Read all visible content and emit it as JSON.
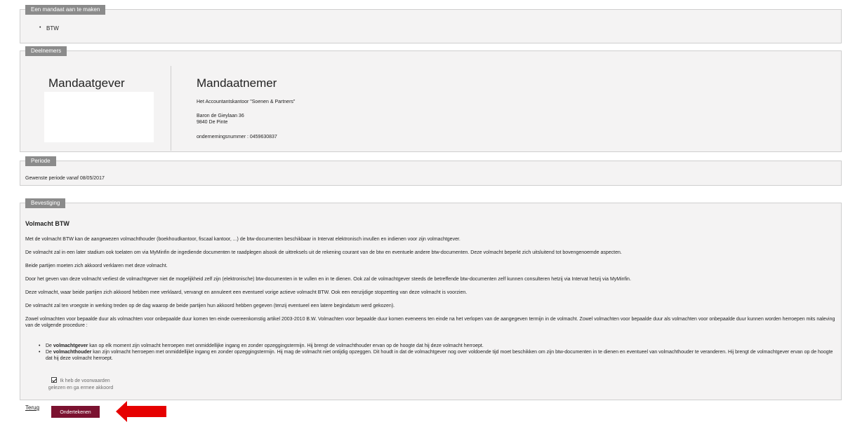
{
  "mandaat": {
    "legend": "Een mandaat aan te maken",
    "items": [
      "BTW"
    ]
  },
  "deelnemers": {
    "legend": "Deelnemers",
    "giver_title": "Mandaatgever",
    "taker_title": "Mandaatnemer",
    "taker_name": "Het Accountantskantoor \"Soenen & Partners\"",
    "taker_street": "Baron de Gieylaan 36",
    "taker_city": "9840 De Pinte",
    "taker_company_number": "ondernemingsnummer : 0459630837"
  },
  "periode": {
    "legend": "Periode",
    "text": "Gewenste periode vanaf 08/05/2017"
  },
  "bevestiging": {
    "legend": "Bevestiging",
    "title": "Volmacht BTW",
    "paragraphs": [
      "Met de volmacht BTW kan de aangewezen volmachthouder (boekhoudkantoor, fiscaal kantoor, ...) de btw-documenten beschikbaar in Intervat elektronisch invullen en indienen voor zijn volmachtgever.",
      "De volmacht zal in een later stadium ook toelaten om via MyMinfin de ingediende documenten te raadplegen alsook de uittreksels uit de rekening courant van de btw en eventuele andere btw-documenten. Deze volmacht beperkt zich uitsluitend tot bovengenoemde aspecten.",
      "Beide partijen moeten zich akkoord verklaren met deze volmacht.",
      "Door het geven van deze volmacht verliest de volmachtgever niet de mogelijkheid zelf zijn (elektronische) btw-documenten in te vullen en in te dienen. Ook zal de volmachtgever steeds de betreffende btw-documenten zelf kunnen consulteren hetzij via Intervat hetzij via MyMinfin.",
      "Deze volmacht, waar beide partijen zich akkoord hebben mee verklaard, vervangt en annuleert een eventueel vorige actieve volmacht BTW. Ook een eenzijdige stopzetting van deze volmacht is voorzien.",
      "De volmacht zal ten vroegste in werking treden op de dag waarop de beide partijen hun akkoord hebben gegeven (tenzij eventueel een latere begindatum werd gekozen).",
      "Zowel volmachten voor bepaalde duur als volmachten voor onbepaalde duur komen ten einde overeenkomstig artikel 2003-2010 B.W. Volmachten voor bepaalde duur komen eveneens ten einde na het verlopen van de aangegeven termijn in de volmacht. Zowel volmachten voor bepaalde duur als volmachten voor onbepaalde duur kunnen worden herroepen mits naleving van de volgende procedure :"
    ],
    "list": [
      {
        "prefix": "De ",
        "bold": "volmachtgever",
        "text": " kan op elk moment zijn volmacht herroepen met onmiddellijke ingang en zonder opzeggingstermijn. Hij brengt de volmachthouder ervan op de hoogte dat hij deze volmacht herroept."
      },
      {
        "prefix": "De ",
        "bold": "volmachthouder",
        "text": " kan zijn volmacht herroepen met onmiddellijke ingang en zonder opzeggingstermijn. Hij mag de volmacht niet ontijdig opzeggen. Dit houdt in dat de volmachtgever nog over voldoende tijd moet beschikken om zijn btw-documenten in te dienen en eventueel van volmachthouder te veranderen. Hij brengt de volmachtgever ervan op de hoogte dat hij deze volmacht herroept."
      }
    ],
    "agree_line1": "Ik heb de voorwaarden",
    "agree_line2": "gelezen en ga ermee akkoord",
    "agree_checked": true
  },
  "actions": {
    "back_label": "Terug",
    "sign_label": "Ondertekenen"
  },
  "colors": {
    "accent": "#7b1230",
    "legend_bg": "#8b8b8b",
    "panel_bg": "#f4f3f3",
    "arrow": "#e60000"
  }
}
